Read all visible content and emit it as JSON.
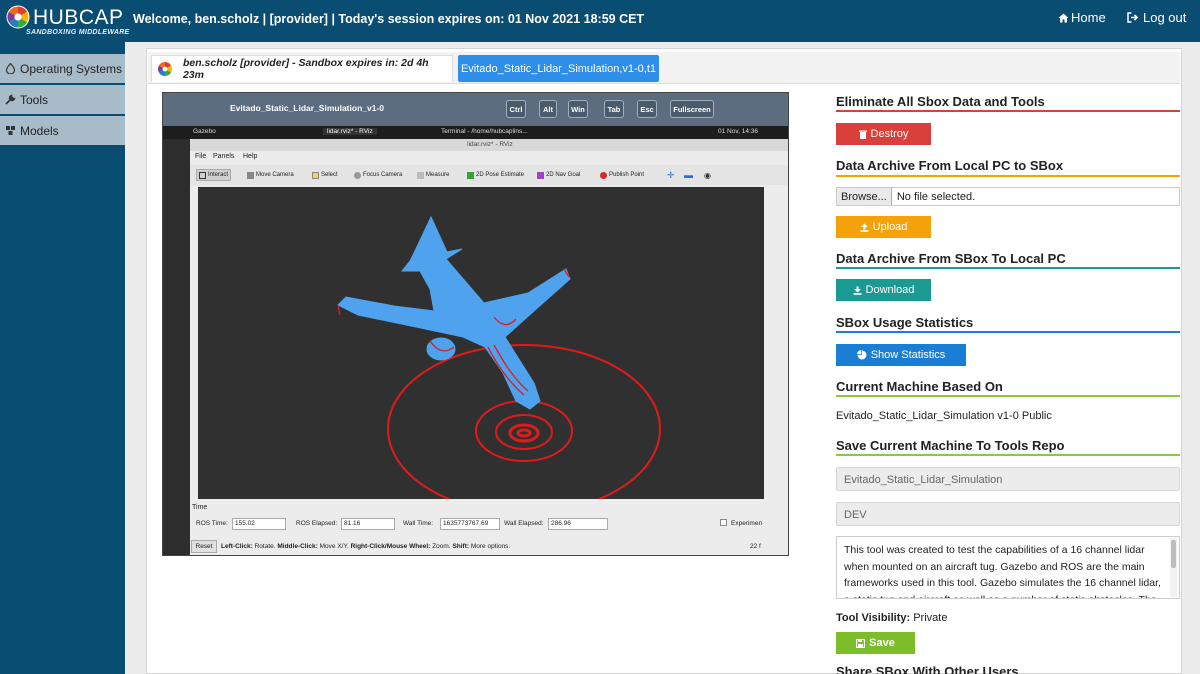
{
  "header": {
    "brand": "HUBCAP",
    "brand_sub": "SANDBOXING MIDDLEWARE",
    "welcome": "Welcome, ben.scholz | [provider] | Today's session expires on: 01 Nov 2021 18:59 CET",
    "home_label": "Home",
    "logout_label": "Log out"
  },
  "sidebar": {
    "items": [
      {
        "label": "Operating Systems",
        "icon": "droplet-icon"
      },
      {
        "label": "Tools",
        "icon": "wrench-icon"
      },
      {
        "label": "Models",
        "icon": "cubes-icon"
      }
    ]
  },
  "tabs": {
    "user_tab": "ben.scholz [provider] - Sandbox expires in: 2d 4h 23m",
    "sim_tab": "Evitado_Static_Lidar_Simulation,v1-0,t1"
  },
  "vnc": {
    "title": "Evitado_Static_Lidar_Simulation_v1-0",
    "buttons": [
      "Ctrl",
      "Alt",
      "Win",
      "Tab",
      "Esc",
      "Fullscreen"
    ],
    "taskbar": {
      "gazebo": "Gazebo",
      "rviz": "lidar.rviz* - RViz",
      "terminal": "Terminal - /home/hubcaplins...",
      "clock": "01 Nov, 14:36"
    },
    "rviz": {
      "window_title": "lidar.rviz* - RViz",
      "menu": [
        "File",
        "Panels",
        "Help"
      ],
      "tools": [
        "Interact",
        "Move Camera",
        "Select",
        "Focus Camera",
        "Measure",
        "2D Pose Estimate",
        "2D Nav Goal",
        "Publish Point"
      ],
      "time": {
        "section_label": "Time",
        "ros_time_label": "ROS Time:",
        "ros_time": "155.02",
        "ros_elapsed_label": "ROS Elapsed:",
        "ros_elapsed": "81.16",
        "wall_time_label": "Wall Time:",
        "wall_time": "1635773767.69",
        "wall_elapsed_label": "Wall Elapsed:",
        "wall_elapsed": "286.96",
        "experimental": "Experimen",
        "reset": "Reset",
        "help_left_click": "Left-Click:",
        "help_rotate": " Rotate. ",
        "help_middle_click": "Middle-Click:",
        "help_move": " Move X/Y. ",
        "help_right_click": "Right-Click/Mouse Wheel:",
        "help_zoom": " Zoom. ",
        "help_shift": "Shift:",
        "help_more": " More options.",
        "fps": "22 f"
      }
    }
  },
  "right": {
    "eliminate_title": "Eliminate All Sbox Data and Tools",
    "destroy_label": "Destroy",
    "archive_up_title": "Data Archive From Local PC to SBox",
    "browse_label": "Browse...",
    "no_file": "No file selected.",
    "upload_label": "Upload",
    "archive_down_title": "Data Archive From SBox To Local PC",
    "download_label": "Download",
    "usage_title": "SBox Usage Statistics",
    "stats_label": "Show Statistics",
    "machine_title": "Current Machine Based On",
    "machine_value": "Evitado_Static_Lidar_Simulation v1-0 Public",
    "save_title": "Save Current Machine To Tools Repo",
    "tool_name": "Evitado_Static_Lidar_Simulation",
    "tool_version": "DEV",
    "description": "This tool was created to test the capabilities of a 16 channel lidar when mounted on an aircraft tug. Gazebo and ROS are the main frameworks used in this tool. Gazebo simulates the 16 channel lidar, a static tug and aircraft as well as a number of static obstacles. The resulting point cloud is visualised in RViz.",
    "visibility_label": "Tool Visibility:",
    "visibility_value": "Private",
    "save_label": "Save",
    "share_title": "Share SBox With Other Users"
  },
  "colors": {
    "header_bg": "#0a4d73",
    "sidebar_item_bg": "#a7bcc8",
    "tab_active": "#2f8ee8",
    "destroy": "#d9403a",
    "upload": "#f5a20a",
    "download": "#1a9a93",
    "stats": "#1b7ed6",
    "save": "#7cbd2a",
    "rule_red": "#d9403a",
    "rule_orange": "#f5a20a",
    "rule_teal": "#1a9a93",
    "rule_blue": "#1b7ed6",
    "rule_green": "#8dc63f",
    "point_cloud": "#4fa3ee",
    "scan_rings": "#e01b1b"
  }
}
